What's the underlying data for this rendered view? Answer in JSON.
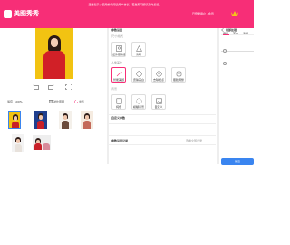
{
  "app": {
    "name": "美图秀秀",
    "notice": "温馨提示：使用前请阅读用户协议，若发现问题请及时反馈。",
    "account": "已登录用户 · 会员"
  },
  "preview": {
    "fit_label": "适应",
    "zoom_value": "100%",
    "compare_label": "对比原图",
    "reset_label": "重置"
  },
  "middle": {
    "title": "参数设置",
    "group1_label": "尺寸/格式",
    "group1_items": [
      "证件照换底",
      "清晰"
    ],
    "group2_label": "人像美化",
    "group2_items": [
      "智能美颜",
      "皮肤美白",
      "去除斑点",
      "瘦脸调整"
    ],
    "group3_label": "背景",
    "group3_items": [
      "纯色",
      "模糊背景",
      "自定义"
    ],
    "custom_label": "自定义参数",
    "history_label": "参数设置记录",
    "history_link": "查看全部记录"
  },
  "right": {
    "title": "局部处理",
    "tab1": "磨皮",
    "tab2": "美白",
    "tab3": "清晰",
    "confirm_label": "确定"
  },
  "colors": {
    "brand": "#f72e77",
    "confirm": "#3a85f0",
    "photo_bg": "#f2c312"
  }
}
